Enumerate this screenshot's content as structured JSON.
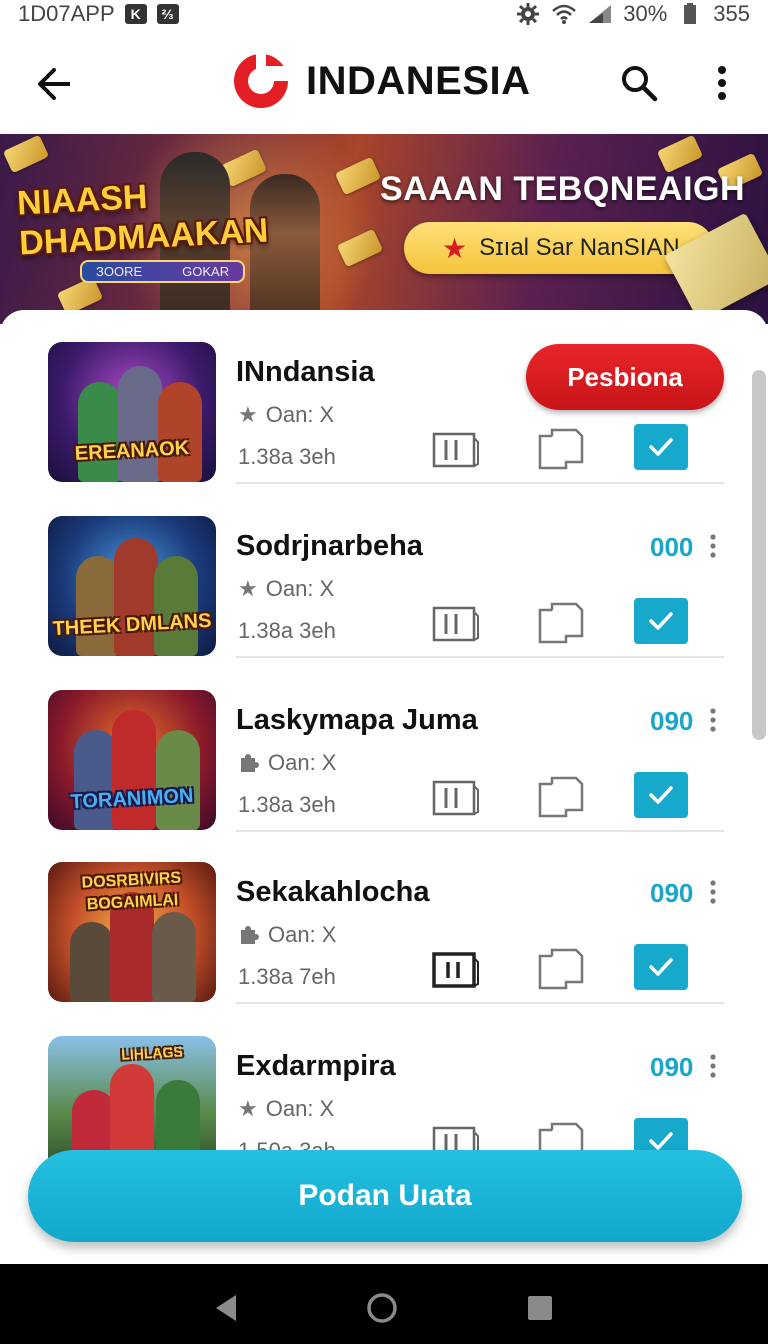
{
  "status_bar": {
    "app_label": "1D07APP",
    "chip_k": "K",
    "chip_m": "⅔",
    "battery": "30%",
    "extra": "355",
    "icons": [
      "gear-icon",
      "wifi-icon",
      "signal-icon",
      "battery-icon"
    ]
  },
  "app_bar": {
    "back_icon": "arrow-left-icon",
    "title": "INDANESIA",
    "search_icon": "search-icon",
    "more_icon": "more-vertical-icon",
    "brand_color": "#e31e24"
  },
  "banner": {
    "game_title": "NIAASH DHADMAAKAN",
    "game_sub_left": "ЗOORE",
    "game_sub_right": "GOKAR",
    "headline": "SAAAN TEBQNEAIGH",
    "pill_label": "Sɪıal Sar NanSIAN"
  },
  "list": {
    "items": [
      {
        "title": "INndansia",
        "meta1": "Oan: X",
        "meta2": "1.38a 3eh",
        "thumb_label": "EREANAOK",
        "action_label": "Pesbiona",
        "count": "",
        "rating_icon": "star-icon"
      },
      {
        "title": "Sodrjnarbeha",
        "meta1": "Oan: X",
        "meta2": "1.38a 3eh",
        "thumb_label": "THEEK DMLANS",
        "count": "000",
        "rating_icon": "star-icon"
      },
      {
        "title": "Laskymapa Juma",
        "meta1": "Oan: X",
        "meta2": "1.38a 3eh",
        "thumb_label": "TORANIMON",
        "count": "090",
        "rating_icon": "puzzle-icon"
      },
      {
        "title": "Sekakahlocha",
        "meta1": "Oan: X",
        "meta2": "1.38a 7eh",
        "thumb_label": "DOSRBIVIRS BOGAIMLAI",
        "count": "090",
        "rating_icon": "puzzle-icon"
      },
      {
        "title": "Exdarmpira",
        "meta1": "Oan: X",
        "meta2": "1.50a 3ah",
        "thumb_label": "LIHLAGS",
        "count": "090",
        "rating_icon": "star-icon"
      }
    ]
  },
  "cta": {
    "label": "Podan Uıata",
    "color": "#16a9cc"
  },
  "nav_bar": {
    "back": "nav-back-icon",
    "home": "nav-home-icon",
    "recents": "nav-recents-icon"
  }
}
